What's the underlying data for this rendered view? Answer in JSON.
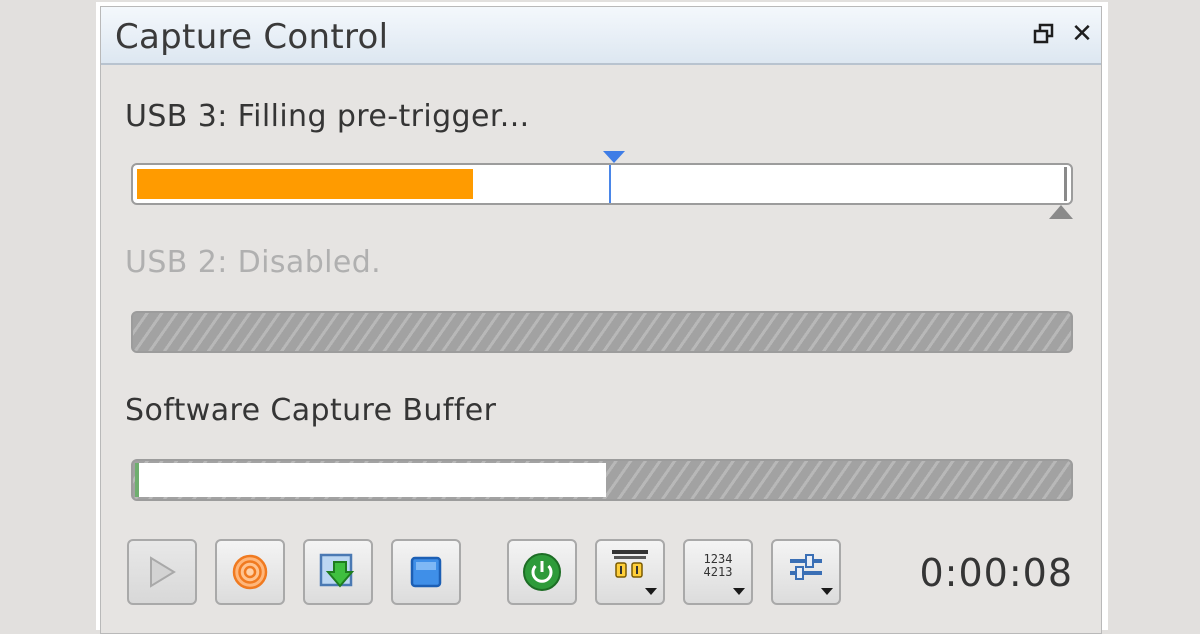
{
  "window": {
    "title": "Capture Control",
    "buttons": [
      "restore-window",
      "close-window"
    ],
    "close_glyph": "✕"
  },
  "usb3": {
    "label": "USB 3: Filling pre-trigger...",
    "fill_fraction": 0.36,
    "trigger_fraction": 0.51,
    "fill_color": "#ff9b00",
    "trigger_color": "#3f7de6"
  },
  "usb2": {
    "label": "USB 2: Disabled.",
    "state": "disabled"
  },
  "software": {
    "label": "Software Capture Buffer",
    "free_fraction": 0.5,
    "start_marker_color": "#6fae6f"
  },
  "toolbar": {
    "buttons": [
      {
        "name": "play",
        "icon": "play-icon",
        "enabled": false
      },
      {
        "name": "record",
        "icon": "target-icon",
        "enabled": true
      },
      {
        "name": "save",
        "icon": "download-arrow-icon",
        "enabled": true
      },
      {
        "name": "stop",
        "icon": "stop-icon",
        "enabled": true
      },
      {
        "name": "power",
        "icon": "power-icon",
        "enabled": true
      },
      {
        "name": "trigger-mode",
        "icon": "trigger-icon",
        "dropdown": true
      },
      {
        "name": "display-format",
        "icon": "numbers-icon",
        "dropdown": true,
        "glyph_text": "1234 4213"
      },
      {
        "name": "settings",
        "icon": "sliders-icon",
        "dropdown": true
      }
    ],
    "numbers_top": "1234",
    "numbers_bottom": "4213",
    "timer": "0:00:08"
  },
  "colors": {
    "accent_blue": "#3f7de6",
    "record_orange": "#ff8c2a",
    "power_green": "#2e9b3a"
  }
}
